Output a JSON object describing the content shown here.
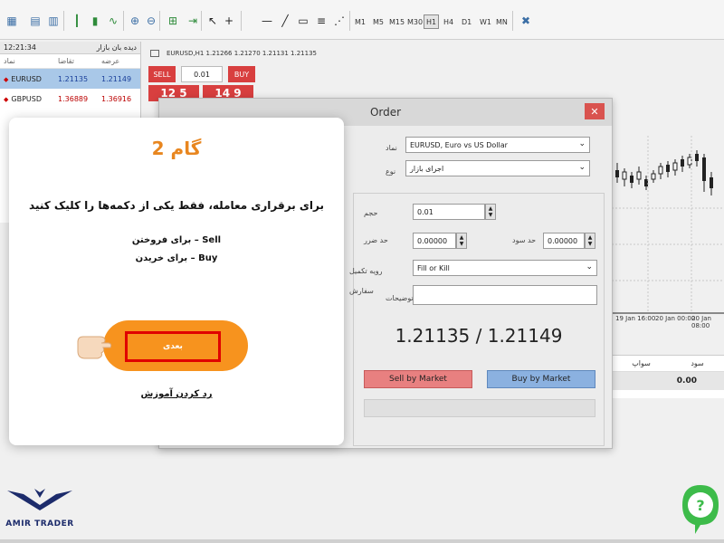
{
  "toolbar": {
    "timeframes": [
      "M1",
      "M5",
      "M15",
      "M30",
      "H1",
      "H4",
      "D1",
      "W1",
      "MN"
    ],
    "active_timeframe": "H1"
  },
  "market_watch": {
    "title_time": "12:21:34",
    "title_label": "دیده بان بازار",
    "columns": {
      "symbol": "نماد",
      "bid": "تقاضا",
      "ask": "عرضه"
    },
    "rows": [
      {
        "symbol": "EURUSD",
        "bid": "1.21135",
        "ask": "1.21149"
      },
      {
        "symbol": "GBPUSD",
        "bid": "1.36889",
        "ask": "1.36916"
      }
    ]
  },
  "chart": {
    "tab_title": "EURUSD,H1  1.21266 1.21270 1.21131 1.21135",
    "sell_label": "SELL",
    "buy_label": "BUY",
    "lot_value": "0.01",
    "sell_price": "12 5",
    "buy_price": "14 9",
    "x_labels": [
      "19 Jan 16:00",
      "20 Jan 00:00",
      "20 Jan 08:00"
    ],
    "bottom_headers": {
      "swap": "سواپ",
      "profit": "سود"
    },
    "profit_value": "0.00"
  },
  "order": {
    "title": "Order",
    "close_glyph": "✕",
    "symbol_label": "نماد",
    "symbol_value": "EURUSD, Euro vs US Dollar",
    "type_label": "نوع",
    "type_value": "اجرای بازار",
    "volume_label": "حجم",
    "volume_value": "0.01",
    "sl_label": "حد ضرر",
    "sl_value": "0.00000",
    "tp_label": "حد سود",
    "tp_value": "0.00000",
    "fill_label": "رویه تکمیل",
    "fill_value": "Fill or Kill",
    "comment_label_1": "سفارش",
    "comment_label_2": "توضیحات",
    "price_display": "1.21135 / 1.21149",
    "sell_button": "Sell by Market",
    "buy_button": "Buy by Market"
  },
  "popup": {
    "step": "گام 2",
    "message": "برای برقراری معامله، فقط یکی از دکمه‌ها را کلیک کنید",
    "sell_line": "Sell – برای فروختن",
    "buy_line": "Buy – برای خریدن",
    "next_button": "بعدی",
    "skip_link": "رد کردن آموزش"
  },
  "brand": {
    "name": "AMIR TRADER"
  },
  "colors": {
    "accent_orange": "#f7931e",
    "sell_red": "#d83f3f",
    "buy_blue": "#8bb1e0",
    "brand_navy": "#1c2b6b",
    "chat_green": "#3dbb4a"
  }
}
